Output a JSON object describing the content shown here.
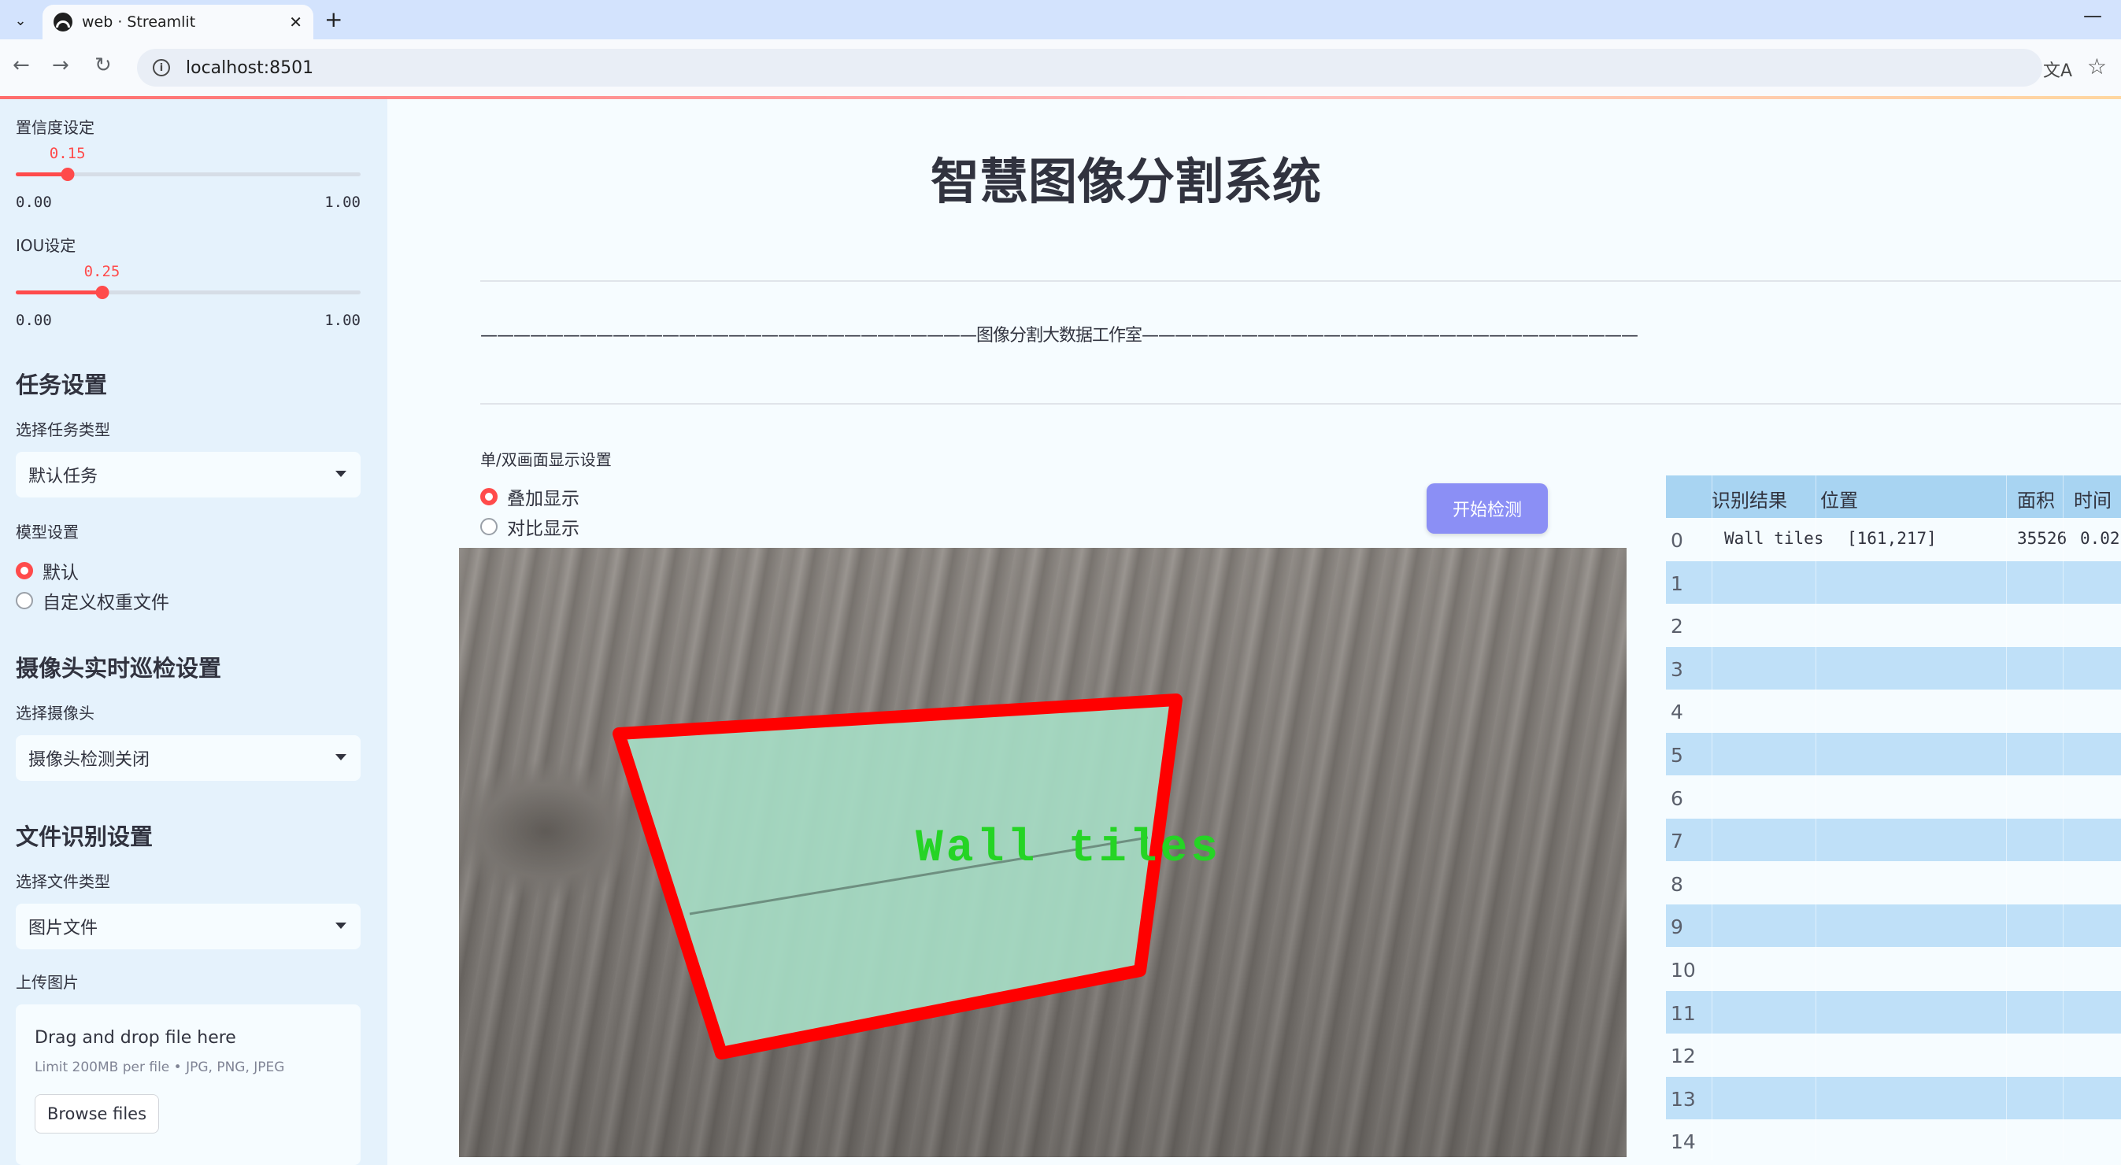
{
  "browser": {
    "tab_title": "web · Streamlit",
    "url": "localhost:8501"
  },
  "sidebar": {
    "confidence": {
      "label": "置信度设定",
      "value": "0.15",
      "value_num": 0.15,
      "min": "0.00",
      "max": "1.00"
    },
    "iou": {
      "label": "IOU设定",
      "value": "0.25",
      "value_num": 0.25,
      "min": "0.00",
      "max": "1.00"
    },
    "task_heading": "任务设置",
    "task_type_label": "选择任务类型",
    "task_type_value": "默认任务",
    "model_label": "模型设置",
    "model_options": [
      "默认",
      "自定义权重文件"
    ],
    "model_selected": 0,
    "camera_heading": "摄像头实时巡检设置",
    "camera_label": "选择摄像头",
    "camera_value": "摄像头检测关闭",
    "file_heading": "文件识别设置",
    "file_type_label": "选择文件类型",
    "file_type_value": "图片文件",
    "upload_label": "上传图片",
    "upload_title": "Drag and drop file here",
    "upload_sub": "Limit 200MB per file • JPG, PNG, JPEG",
    "browse_label": "Browse files"
  },
  "main": {
    "title": "智慧图像分割系统",
    "divider_text": "——————————————————————————————图像分割大数据工作室——————————————————————————————",
    "display_label": "单/双画面显示设置",
    "display_options": [
      "叠加显示",
      "对比显示"
    ],
    "display_selected": 0,
    "start_button": "开始检测",
    "detection_label": "Wall  tiles"
  },
  "table": {
    "headers": [
      "识别结果",
      "位置",
      "面积",
      "时间"
    ],
    "row_indices": [
      "0",
      "1",
      "2",
      "3",
      "4",
      "5",
      "6",
      "7",
      "8",
      "9",
      "10",
      "11",
      "12",
      "13",
      "14"
    ],
    "rows": [
      {
        "result": "Wall tiles",
        "position": "[161,217]",
        "area": "35526",
        "time": "0.02"
      }
    ]
  },
  "colors": {
    "accent": "#ff4b4b",
    "button": "#8b8ff5",
    "sidebar_bg": "#e5f2fc",
    "table_header": "#a8d4f2",
    "detection_box": "#ff0000",
    "detection_label": "#25d425"
  }
}
